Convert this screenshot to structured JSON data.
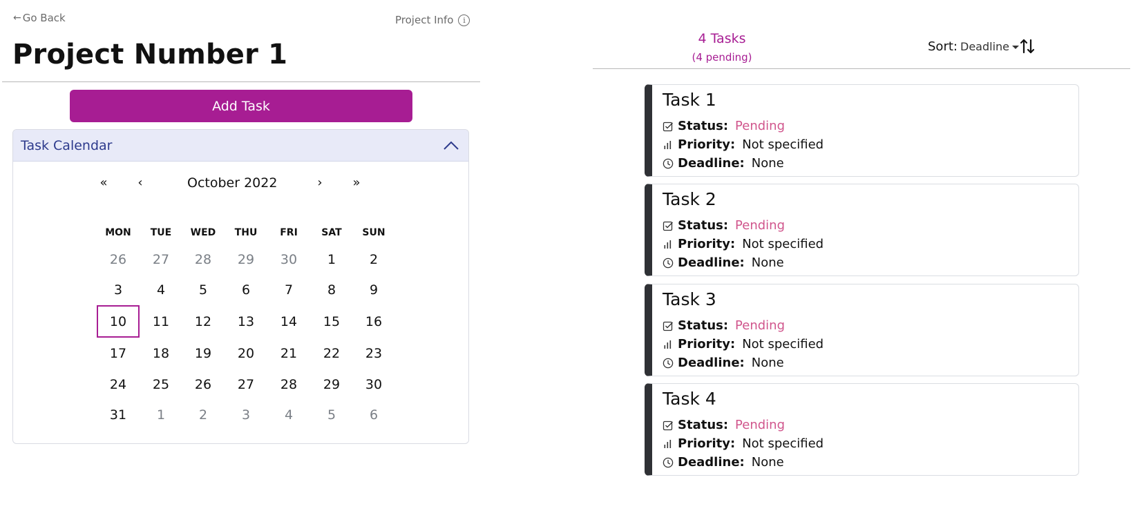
{
  "nav": {
    "go_back": "Go Back",
    "project_info": "Project Info"
  },
  "project": {
    "title": "Project Number 1"
  },
  "actions": {
    "add_task": "Add Task"
  },
  "calendar": {
    "header": "Task Calendar",
    "month_label": "October 2022",
    "nav": {
      "prev_year": "«",
      "prev_month": "‹",
      "next_month": "›",
      "next_year": "»"
    },
    "weekdays": [
      "MON",
      "TUE",
      "WED",
      "THU",
      "FRI",
      "SAT",
      "SUN"
    ],
    "weeks": [
      [
        "26",
        "27",
        "28",
        "29",
        "30",
        "1",
        "2"
      ],
      [
        "3",
        "4",
        "5",
        "6",
        "7",
        "8",
        "9"
      ],
      [
        "10",
        "11",
        "12",
        "13",
        "14",
        "15",
        "16"
      ],
      [
        "17",
        "18",
        "19",
        "20",
        "21",
        "22",
        "23"
      ],
      [
        "24",
        "25",
        "26",
        "27",
        "28",
        "29",
        "30"
      ],
      [
        "31",
        "1",
        "2",
        "3",
        "4",
        "5",
        "6"
      ]
    ],
    "selected_day": "10"
  },
  "summary": {
    "tasks_count": "4 Tasks",
    "pending": "(4 pending)"
  },
  "sort": {
    "label": "Sort:",
    "value": "Deadline"
  },
  "tasks": [
    {
      "title": "Task 1",
      "status_label": "Status:",
      "status": "Pending",
      "priority_label": "Priority:",
      "priority": "Not specified",
      "deadline_label": "Deadline:",
      "deadline": "None"
    },
    {
      "title": "Task 2",
      "status_label": "Status:",
      "status": "Pending",
      "priority_label": "Priority:",
      "priority": "Not specified",
      "deadline_label": "Deadline:",
      "deadline": "None"
    },
    {
      "title": "Task 3",
      "status_label": "Status:",
      "status": "Pending",
      "priority_label": "Priority:",
      "priority": "Not specified",
      "deadline_label": "Deadline:",
      "deadline": "None"
    },
    {
      "title": "Task 4",
      "status_label": "Status:",
      "status": "Pending",
      "priority_label": "Priority:",
      "priority": "Not specified",
      "deadline_label": "Deadline:",
      "deadline": "None"
    }
  ],
  "colors": {
    "accent": "#a71d93",
    "pending": "#d0558c",
    "calendar_header_bg": "#e8eaf8",
    "calendar_header_text": "#2d3a8c",
    "card_edge": "#2f3135"
  },
  "icons": {
    "back": "arrow-left-icon",
    "info": "info-circle-icon",
    "collapse": "chevron-up-icon",
    "sort": "sort-arrows-icon",
    "status": "check-square-icon",
    "priority": "bar-chart-icon",
    "deadline": "clock-icon"
  }
}
